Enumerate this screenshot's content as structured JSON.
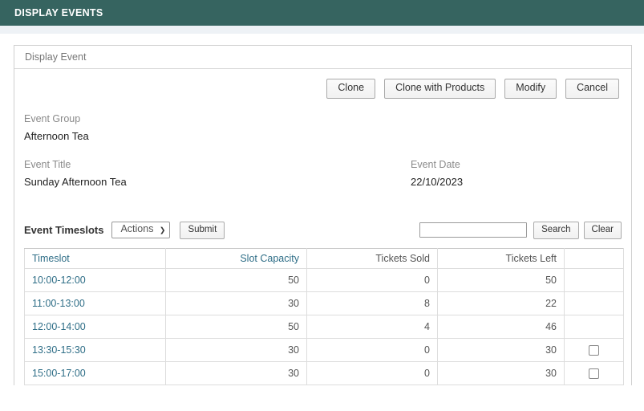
{
  "app_bar": {
    "title": "DISPLAY EVENTS"
  },
  "panel": {
    "title": "Display Event",
    "actions": [
      {
        "name": "clone",
        "label": "Clone"
      },
      {
        "name": "clone-with-products",
        "label": "Clone with Products"
      },
      {
        "name": "modify",
        "label": "Modify"
      },
      {
        "name": "cancel",
        "label": "Cancel"
      }
    ],
    "fields": {
      "event_group": {
        "label": "Event Group",
        "value": "Afternoon Tea"
      },
      "event_title": {
        "label": "Event Title",
        "value": "Sunday Afternoon Tea"
      },
      "event_date": {
        "label": "Event Date",
        "value": "22/10/2023"
      }
    }
  },
  "timeslots": {
    "section_title": "Event Timeslots",
    "actions_select": {
      "selected": "Actions",
      "options": [
        "Actions"
      ],
      "chevron": "chevron-down-icon"
    },
    "submit_label": "Submit",
    "search": {
      "value": "",
      "placeholder": "",
      "search_label": "Search",
      "clear_label": "Clear"
    },
    "columns": [
      {
        "label": "Timeslot",
        "align": "left",
        "link": true
      },
      {
        "label": "Slot Capacity",
        "align": "right",
        "link": true
      },
      {
        "label": "Tickets Sold",
        "align": "right",
        "link": false
      },
      {
        "label": "Tickets Left",
        "align": "right",
        "link": false
      },
      {
        "label": "",
        "align": "center",
        "link": false
      }
    ],
    "rows": [
      {
        "timeslot": "10:00-12:00",
        "slot_capacity": "50",
        "tickets_sold": "0",
        "tickets_left": "50",
        "checkbox": false
      },
      {
        "timeslot": "11:00-13:00",
        "slot_capacity": "30",
        "tickets_sold": "8",
        "tickets_left": "22",
        "checkbox": false
      },
      {
        "timeslot": "12:00-14:00",
        "slot_capacity": "50",
        "tickets_sold": "4",
        "tickets_left": "46",
        "checkbox": false
      },
      {
        "timeslot": "13:30-15:30",
        "slot_capacity": "30",
        "tickets_sold": "0",
        "tickets_left": "30",
        "checkbox": true
      },
      {
        "timeslot": "15:00-17:00",
        "slot_capacity": "30",
        "tickets_sold": "0",
        "tickets_left": "30",
        "checkbox": true
      }
    ]
  },
  "colors": {
    "app_bar": "#366460",
    "link": "#2f6e87",
    "label": "#8a8a8a",
    "strip": "#eef2f6"
  }
}
